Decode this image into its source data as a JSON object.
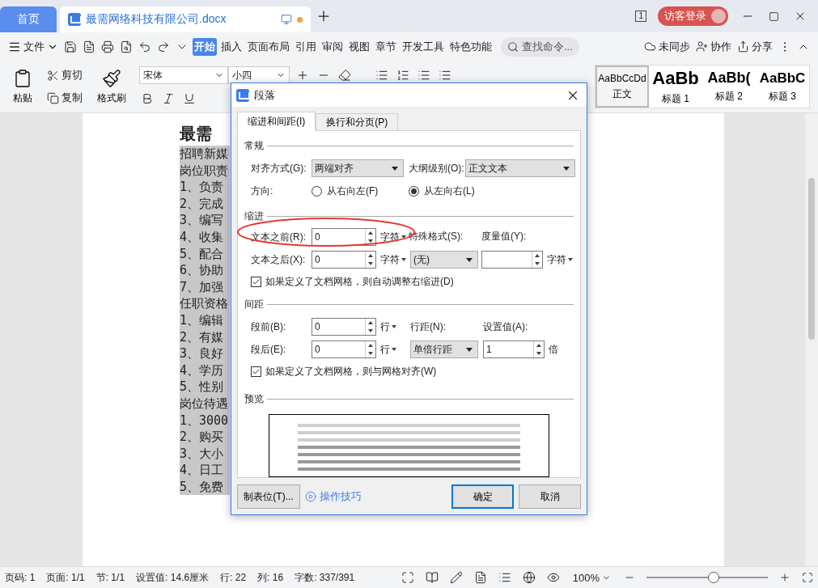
{
  "tabs": [
    {
      "label": "首页",
      "kind": "home",
      "selected": false
    },
    {
      "label": "最需网络科技有限公司.docx",
      "kind": "doc",
      "selected": true
    }
  ],
  "account": {
    "page_count": "1",
    "login": "访客登录"
  },
  "menu": {
    "file": "文件",
    "tabs": [
      {
        "label": "开始",
        "selected": true
      },
      {
        "label": "插入",
        "selected": false
      },
      {
        "label": "页面布局",
        "selected": false
      },
      {
        "label": "引用",
        "selected": false
      },
      {
        "label": "审阅",
        "selected": false
      },
      {
        "label": "视图",
        "selected": false
      },
      {
        "label": "章节",
        "selected": false
      },
      {
        "label": "开发工具",
        "selected": false
      },
      {
        "label": "特色功能",
        "selected": false
      }
    ],
    "search_placeholder": "查找命令...",
    "actions": [
      {
        "label": "未同步",
        "kind": "sync"
      },
      {
        "label": "协作",
        "kind": "collab"
      },
      {
        "label": "分享",
        "kind": "share"
      }
    ]
  },
  "ribbon": {
    "paste": "粘贴",
    "cut": "剪切",
    "copy": "复制",
    "format_painter": "格式刷",
    "font": "宋体",
    "size": "小四",
    "styles": [
      {
        "preview": "AaBbCcDd",
        "label": "正文",
        "kind": "body",
        "selected": true
      },
      {
        "preview": "AaBb",
        "label": "标题 1",
        "kind": "h1",
        "selected": false
      },
      {
        "preview": "AaBb(",
        "label": "标题 2",
        "kind": "h2",
        "selected": false
      },
      {
        "preview": "AaBbC",
        "label": "标题 3",
        "kind": "h3",
        "selected": false
      }
    ]
  },
  "document": {
    "heading": "最需",
    "lines": [
      "招聘新媒",
      "岗位职责",
      "1、负责",
      "2、完成",
      "3、编写",
      "4、收集",
      "5、配合",
      "6、协助",
      "7、加强",
      "任职资格",
      "1、编辑",
      "2、有媒",
      "3、良好",
      "4、学历",
      "5、性别",
      "岗位待遇",
      "1、3000",
      "2、购买",
      "3、大小",
      "4、日工",
      "5、免费"
    ]
  },
  "dialog": {
    "title": "段落",
    "tabs": [
      {
        "label": "缩进和间距(I)",
        "selected": true
      },
      {
        "label": "换行和分页(P)",
        "selected": false
      }
    ],
    "general": {
      "heading": "常规",
      "alignment_label": "对齐方式(G):",
      "alignment": "两端对齐",
      "outline_label": "大纲级别(O):",
      "outline": "正文文本",
      "direction_label": "方向:",
      "directions": [
        {
          "label": "从右向左(F)",
          "selected": false
        },
        {
          "label": "从左向右(L)",
          "selected": true
        }
      ]
    },
    "indent": {
      "heading": "缩进",
      "before_label": "文本之前(R):",
      "before": "0",
      "before_unit": "字符",
      "after_label": "文本之后(X):",
      "after": "0",
      "after_unit": "字符",
      "special_label": "特殊格式(S):",
      "special": "(无)",
      "measure_label": "度量值(Y):",
      "measure_unit": "字符",
      "auto_adjust": {
        "label": "如果定义了文档网格，则自动调整右缩进(D)",
        "checked": true
      }
    },
    "spacing": {
      "heading": "间距",
      "before_label": "段前(B):",
      "before": "0",
      "before_unit": "行",
      "after_label": "段后(E):",
      "after": "0",
      "after_unit": "行",
      "line_label": "行距(N):",
      "line": "单倍行距",
      "value_label": "设置值(A):",
      "value": "1",
      "value_unit": "倍",
      "snap": {
        "label": "如果定义了文档网格，则与网格对齐(W)",
        "checked": true
      }
    },
    "preview": {
      "heading": "预览"
    },
    "tabs_button": "制表位(T)...",
    "tips_link": "操作技巧",
    "ok": "确定",
    "cancel": "取消"
  },
  "status_bar": {
    "items": [
      "页码: 1",
      "页面: 1/1",
      "节: 1/1",
      "设置值: 14.6厘米",
      "行: 22",
      "列: 16",
      "字数: 337/391"
    ],
    "zoom": "100%",
    "zoom_slider": {
      "level": 0.55
    }
  }
}
